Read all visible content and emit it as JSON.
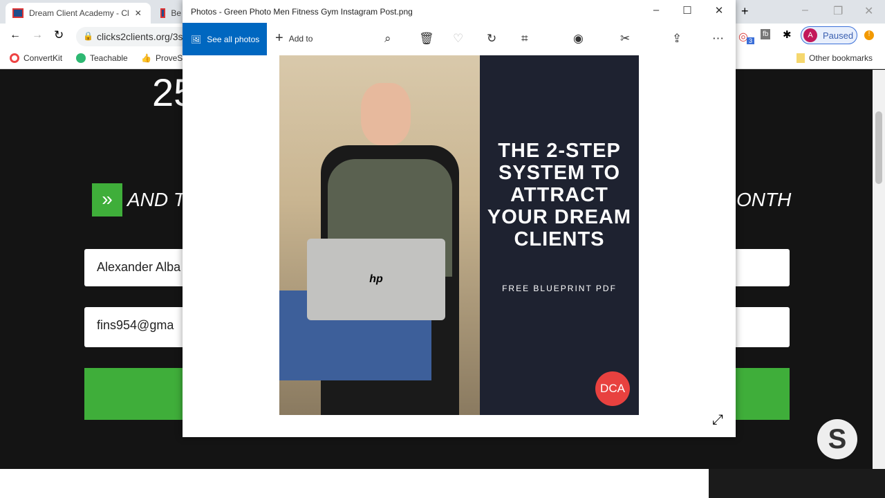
{
  "browser": {
    "tabs": [
      {
        "label": "Dream Client Academy - Cl"
      },
      {
        "label": "Be"
      }
    ],
    "url": "clicks2clients.org/3s",
    "profile_label": "Paused",
    "profile_initial": "A",
    "ext_badge": "3",
    "bookmarks": [
      {
        "label": "ConvertKit"
      },
      {
        "label": "Teachable"
      },
      {
        "label": "ProveS"
      }
    ],
    "other_bookmarks": "Other bookmarks"
  },
  "page": {
    "heading_partial": "25",
    "line_left": "AND T",
    "line_right": "ONTH",
    "name_value": "Alexander Alba",
    "email_value": "fins954@gma"
  },
  "photos": {
    "title": "Photos - Green Photo Men Fitness Gym Instagram Post.png",
    "see_all": "See all photos",
    "add_to": "Add to",
    "image": {
      "headline": "THE 2-STEP SYSTEM TO ATTRACT YOUR DREAM CLIENTS",
      "subline": "FREE BLUEPRINT PDF",
      "logo": "DCA",
      "laptop_logo": "hp"
    }
  },
  "colors": {
    "accent": "#0067c0",
    "green": "#3fae3a",
    "panel": "#1e2230",
    "logo_red": "#e8413f"
  }
}
